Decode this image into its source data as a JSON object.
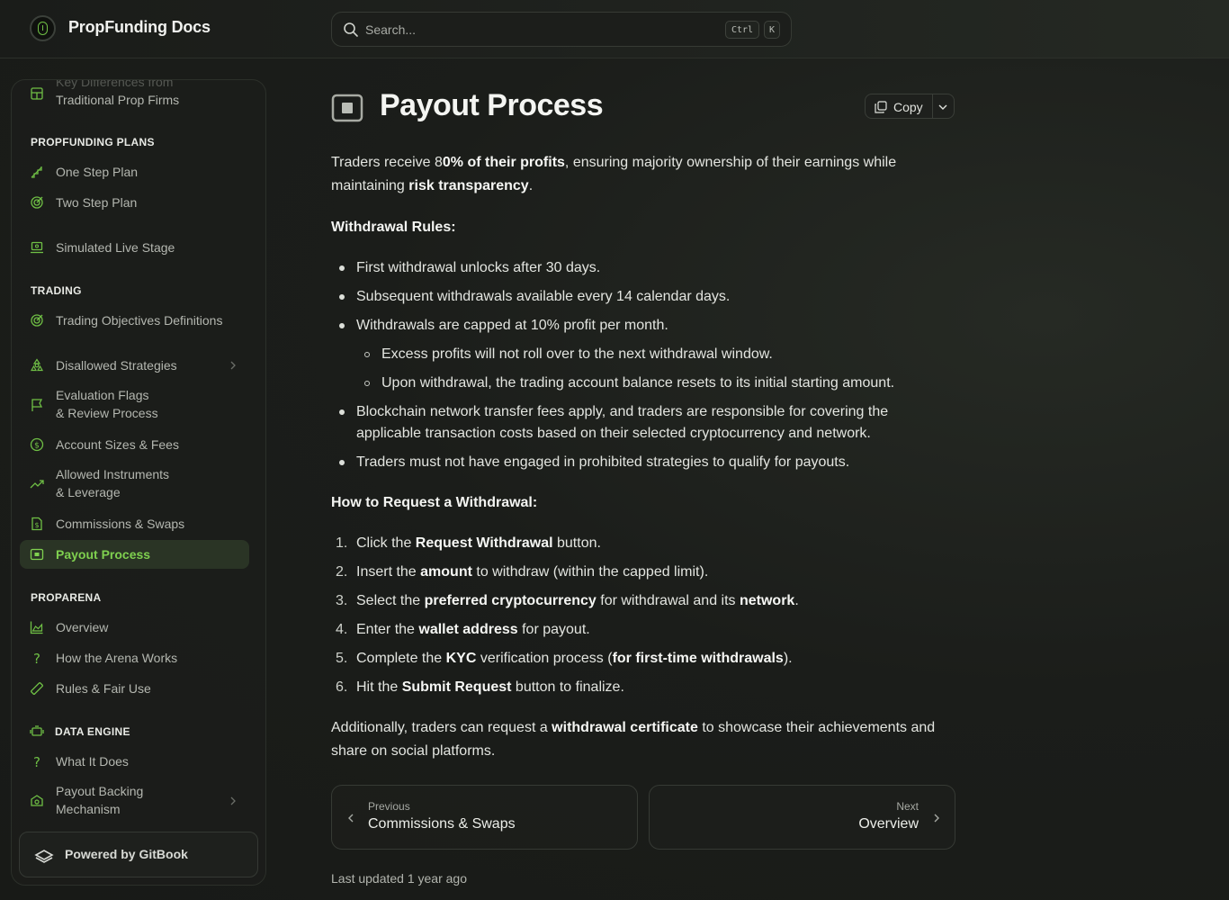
{
  "header": {
    "brand": "PropFunding Docs",
    "search_placeholder": "Search...",
    "shortcut_keys": [
      "Ctrl",
      "K"
    ]
  },
  "sidebar": {
    "partial_item": {
      "label_hidden": "Key Differences from",
      "label": "Traditional Prop Firms",
      "icon": "grid-icon"
    },
    "sections": [
      {
        "heading": "PROPFUNDING PLANS",
        "items": [
          {
            "label": "One Step Plan",
            "icon": "steps-icon"
          },
          {
            "label": "Two Step Plan",
            "icon": "target-icon"
          },
          {
            "label": "Simulated Live Stage",
            "icon": "monitor-icon"
          }
        ]
      },
      {
        "heading": "TRADING",
        "items": [
          {
            "label": "Trading Objectives Definitions",
            "icon": "target-icon"
          },
          {
            "label": "Disallowed Strategies",
            "icon": "hazard-icon",
            "expandable": true
          },
          {
            "label": "Evaluation Flags",
            "label2": "& Review Process",
            "icon": "flag-icon"
          },
          {
            "label": "Account Sizes & Fees",
            "icon": "dollar-circle-icon"
          },
          {
            "label": "Allowed Instruments",
            "label2": "& Leverage",
            "icon": "trend-up-icon"
          },
          {
            "label": "Commissions & Swaps",
            "icon": "receipt-icon"
          },
          {
            "label": "Payout Process",
            "icon": "payout-icon",
            "active": true
          }
        ]
      },
      {
        "heading": "PROPARENA",
        "items": [
          {
            "label": "Overview",
            "icon": "chart-area-icon"
          },
          {
            "label": "How the Arena Works",
            "icon": "question-icon"
          },
          {
            "label": "Rules & Fair Use",
            "icon": "ruler-icon"
          }
        ]
      },
      {
        "heading": "DATA ENGINE",
        "items": [
          {
            "label": "What It Does",
            "icon": "question-icon"
          },
          {
            "label": "Payout Backing",
            "label2": "Mechanism",
            "icon": "money-check-icon",
            "expandable": true
          }
        ]
      }
    ],
    "powered_by": "Powered by GitBook"
  },
  "page": {
    "title": "Payout Process",
    "copy_label": "Copy",
    "intro": {
      "t1": "Traders receive ",
      "t2": "8",
      "b1": "0% of their profits",
      "t3": ", ensuring majority ownership of their earnings while maintaining ",
      "b2": "risk transparency",
      "t4": "."
    },
    "withdrawal_rules_heading": "Withdrawal Rules:",
    "rules": [
      "First withdrawal unlocks after 30 days.",
      "Subsequent withdrawals available every 14 calendar days.",
      "Withdrawals are capped at 10% profit per month."
    ],
    "sub_rules": [
      "Excess profits will not roll over to the next withdrawal window.",
      "Upon withdrawal, the trading account balance resets to its initial starting amount."
    ],
    "rules_after": [
      "Blockchain network transfer fees apply, and traders are responsible for covering the applicable transaction costs based on their selected cryptocurrency and network.",
      "Traders must not have engaged in prohibited strategies to qualify for payouts."
    ],
    "request_heading": "How to Request a Withdrawal:",
    "steps": [
      {
        "n": "1.",
        "a": "Click the ",
        "b": "Request Withdrawal",
        "c": " button."
      },
      {
        "n": "2.",
        "a": "Insert the ",
        "b": "amount",
        "c": " to withdraw (within the capped limit)."
      },
      {
        "n": "3.",
        "a": "Select the ",
        "b": "preferred cryptocurrency",
        "c": " for withdrawal and its ",
        "d": "network",
        "e": "."
      },
      {
        "n": "4.",
        "a": "Enter the ",
        "b": "wallet address",
        "c": " for payout."
      },
      {
        "n": "5.",
        "a": "Complete the ",
        "b": "KYC",
        "c": " verification process (",
        "d": "for first-time withdrawals",
        "e": ")."
      },
      {
        "n": "6.",
        "a": "Hit the ",
        "b": "Submit Request",
        "c": " button to finalize."
      }
    ],
    "closing": {
      "a": "Additionally, traders can request a ",
      "b": "withdrawal certificate",
      "c": " to showcase their achievements and share on social platforms."
    },
    "prev": {
      "small": "Previous",
      "label": "Commissions & Swaps"
    },
    "next": {
      "small": "Next",
      "label": "Overview"
    },
    "last_updated": "Last updated 1 year ago"
  },
  "colors": {
    "accent": "#7fd04f",
    "background": "#1b1d1a"
  }
}
